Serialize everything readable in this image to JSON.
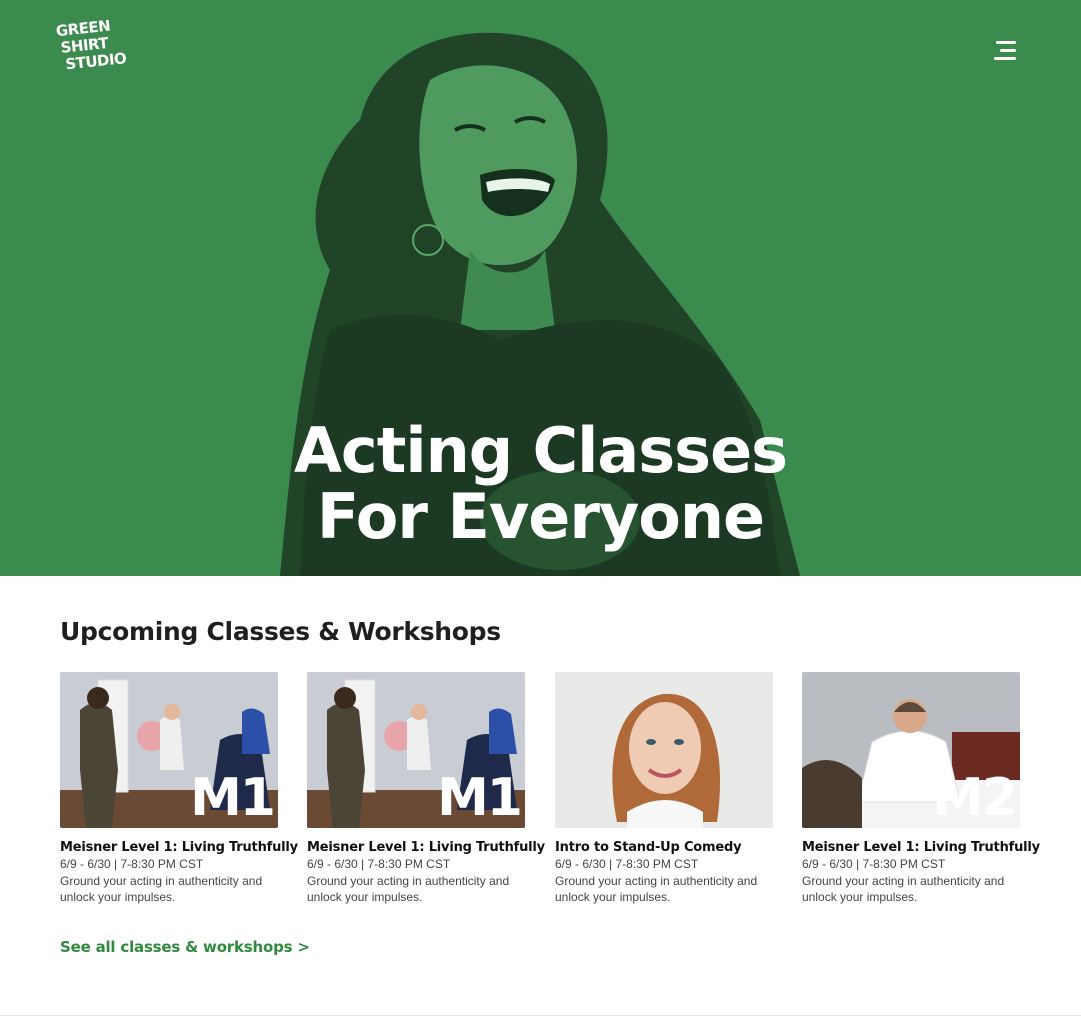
{
  "brand": {
    "logo_lines": [
      "GREEN",
      "SHIRT",
      "STUDIO"
    ]
  },
  "header": {
    "menu_icon": "hamburger-menu-icon"
  },
  "hero": {
    "title_line1": "Acting Classes",
    "title_line2": "For Everyone"
  },
  "classes": {
    "heading": "Upcoming Classes & Workshops",
    "items": [
      {
        "badge": "M1",
        "title": "Meisner Level 1: Living Truthfully",
        "dates": "6/9 - 6/30 | 7-8:30 PM CST",
        "description": "Ground your acting in authenticity and unlock your impulses."
      },
      {
        "badge": "M1",
        "title": "Meisner Level 1: Living Truthfully",
        "dates": "6/9 - 6/30 | 7-8:30 PM CST",
        "description": "Ground your acting in authenticity and unlock your impulses."
      },
      {
        "badge": "",
        "title": "Intro to Stand-Up Comedy",
        "dates": "6/9 - 6/30 | 7-8:30 PM CST",
        "description": "Ground your acting in authenticity and unlock your impulses."
      },
      {
        "badge": "M2",
        "title": "Meisner Level 1: Living Truthfully",
        "dates": "6/9 - 6/30 | 7-8:30 PM CST",
        "description": "Ground your acting in authenticity and unlock your impulses."
      }
    ],
    "see_all_label": "See all classes & workshops >"
  },
  "colors": {
    "hero_green": "#3b8a4e",
    "link_green": "#2f8a3e",
    "text_dark": "#1f1f1f"
  }
}
